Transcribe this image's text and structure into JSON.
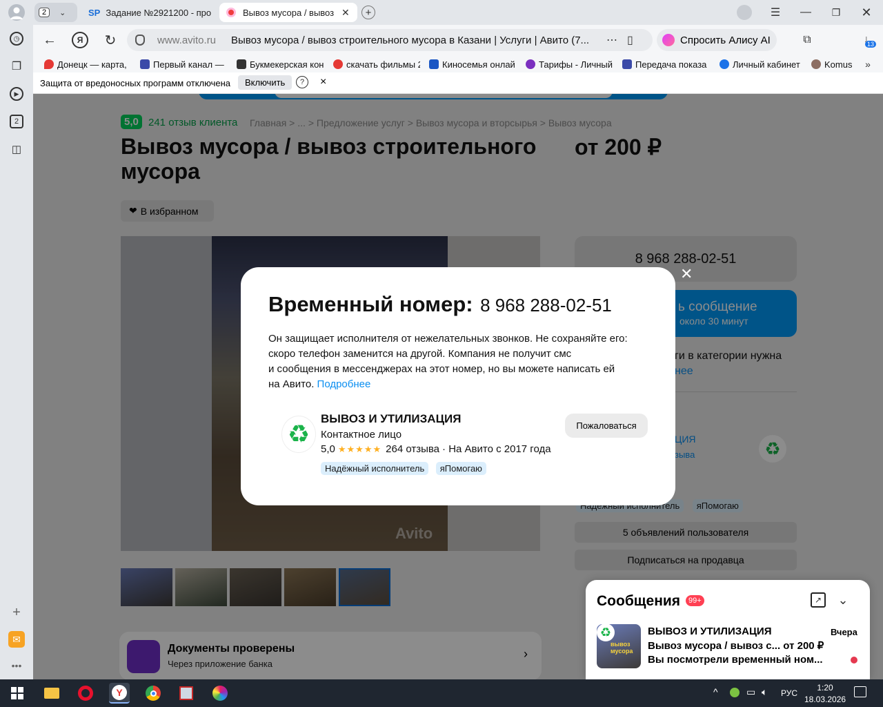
{
  "browser": {
    "tab_count": "2",
    "tabs": [
      {
        "icon_text": "SP",
        "title": "Задание №2921200 - про"
      },
      {
        "title": "Вывоз мусора / вывоз"
      }
    ],
    "address": {
      "domain": "www.avito.ru",
      "page_title": "Вывоз мусора / вывоз строительного мусора в Казани | Услуги | Авито (7..."
    },
    "alice_label": "Спросить Алису AI",
    "downloads_badge": "13",
    "sidebar_badge": "2",
    "bookmarks": [
      {
        "label": "Донецк — карта, с",
        "color": "#e53935"
      },
      {
        "label": "Первый канал — с",
        "color": "#3b4aa8"
      },
      {
        "label": "Букмекерская кон",
        "color": "#333333"
      },
      {
        "label": "скачать фильмы 2",
        "color": "#e53935"
      },
      {
        "label": "Киносемья онлай",
        "color": "#1a56c4"
      },
      {
        "label": "Тарифы - Личный",
        "color": "#7b2fbf"
      },
      {
        "label": "Передача показа",
        "color": "#3b4aa8"
      },
      {
        "label": "Личный кабинет",
        "color": "#1b72e8"
      },
      {
        "label": "Komus",
        "color": "#8d6e63"
      }
    ],
    "infobar": {
      "text": "Защита от вредоносных программ отключена",
      "button": "Включить",
      "help": "?",
      "close": "×"
    }
  },
  "page": {
    "rating": "5,0",
    "reviews_link": "241 отзыв клиента",
    "breadcrumbs": [
      "Главная",
      "...",
      "Предложение услуг",
      "Вывоз мусора и вторсырья",
      "Вывоз мусора"
    ],
    "title": "Вывоз мусора / вывоз строительного мусора",
    "price": "от 200 ₽",
    "favorite": "В избранном",
    "phone_button": "8 968 288-02-51",
    "message_button": {
      "line1": "ь сообщение",
      "line2": "около 30 минут"
    },
    "category_note": {
      "line1": "ги в категории нужна",
      "line2": "нее"
    },
    "seller_side": {
      "name": "ЦИЯ",
      "sub": "зыва"
    },
    "side_badges": [
      "Надёжный исполнитель",
      "яПомогаю"
    ],
    "ads_button": "5 объявлений пользователя",
    "subscribe_button": "Подписаться на продавца",
    "docs": {
      "title": "Документы проверены",
      "subtitle": "Через приложение банка"
    },
    "photo_watermark": "Avito"
  },
  "messages": {
    "title": "Сообщения",
    "badge": "99+",
    "item": {
      "name": "ВЫВОЗ И УТИЛИЗАЦИЯ",
      "time": "Вчера",
      "subject": "Вывоз мусора / вывоз с...",
      "price": "от 200 ₽",
      "preview": "Вы посмотрели временный ном..."
    },
    "thumb_label": "вывоз мусора"
  },
  "modal": {
    "title": "Временный номер:",
    "phone": "8 968 288-02-51",
    "description_lines": [
      "Он защищает исполнителя от нежелательных звонков. Не сохраняйте его:",
      "скоро телефон заменится на другой. Компания не получит смс",
      "и сообщения в мессенджерах на этот номер, но вы можете написать ей",
      "на Авито."
    ],
    "more_link": "Подробнее",
    "seller": {
      "name": "ВЫВОЗ И УТИЛИЗАЦИЯ",
      "role": "Контактное лицо",
      "rating": "5,0",
      "reviews": "264 отзыва",
      "since": "· На Авито с 2017 года",
      "stars": 5
    },
    "badges": [
      "Надёжный исполнитель",
      "яПомогаю"
    ],
    "report_button": "Пожаловаться",
    "close": "✕"
  },
  "taskbar": {
    "language": "РУС",
    "time": "1:20",
    "date": "18.03.2026"
  },
  "colors": {
    "accent": "#0099f7",
    "green": "#02d15c",
    "star": "#ffb021",
    "link": "#0a8ef0"
  }
}
